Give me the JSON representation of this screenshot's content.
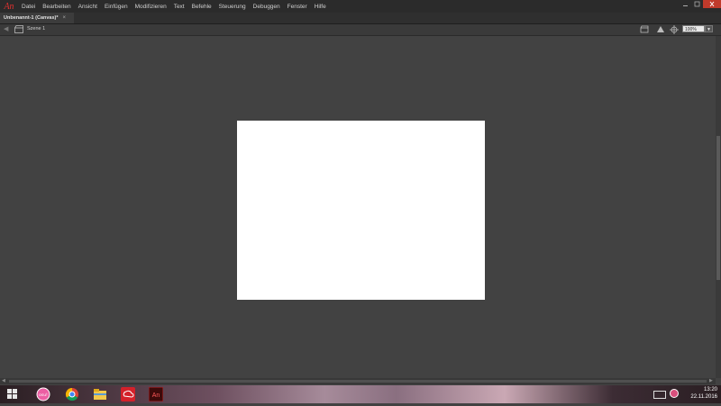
{
  "app": {
    "logo": "An"
  },
  "menu": [
    "Datei",
    "Bearbeiten",
    "Ansicht",
    "Einfügen",
    "Modifizieren",
    "Text",
    "Befehle",
    "Steuerung",
    "Debuggen",
    "Fenster",
    "Hilfe"
  ],
  "document_tab": {
    "title": "Unbenannt-1 (Canvas)*",
    "close": "×"
  },
  "editbar": {
    "scene_label": "Szene 1",
    "zoom": "100%"
  },
  "stage": {
    "background": "#ffffff"
  },
  "taskbar": {
    "time": "13:20",
    "date": "22.11.2016"
  },
  "icons": [
    "adobe-animate-logo",
    "back-arrow-icon",
    "clapperboard-icon",
    "edit-symbols-icon",
    "edit-scene-icon",
    "center-stage-icon",
    "chevron-down-icon",
    "windows-start-icon",
    "osu-icon",
    "chrome-icon",
    "file-explorer-icon",
    "creative-cloud-icon",
    "animate-icon",
    "keyboard-icon",
    "power-icon"
  ]
}
